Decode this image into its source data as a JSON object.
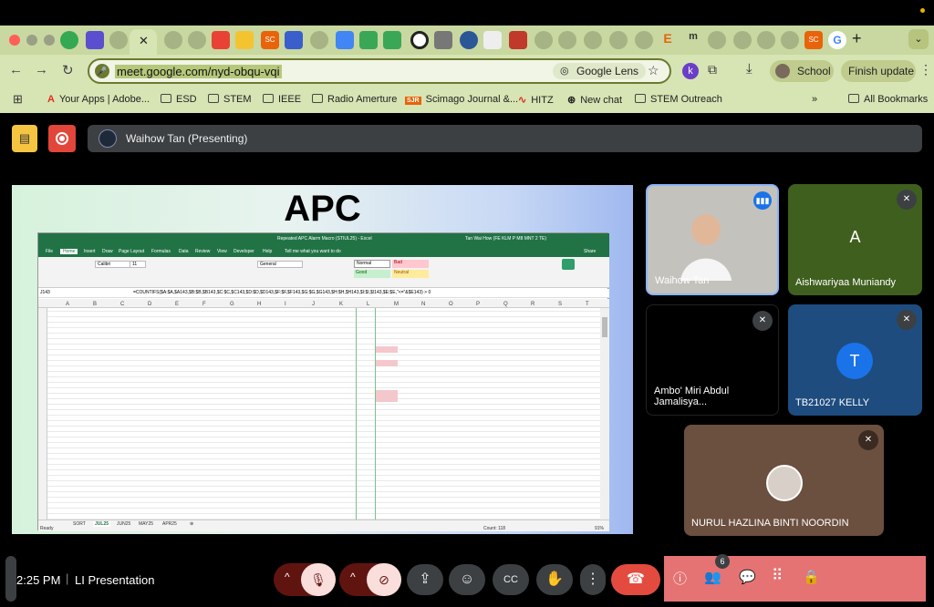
{
  "browser": {
    "url": "meet.google.com/nyd-obqu-vqi",
    "lens_label": "Google Lens",
    "profile_label": "School",
    "update_label": "Finish update",
    "extension_letter": "k"
  },
  "bookmarks": [
    {
      "label": "Your Apps | Adobe..."
    },
    {
      "label": "ESD"
    },
    {
      "label": "STEM"
    },
    {
      "label": "IEEE"
    },
    {
      "label": "Radio Amerture"
    },
    {
      "label": "Scimago Journal &..."
    },
    {
      "label": "HITZ"
    },
    {
      "label": "New chat"
    },
    {
      "label": "STEM Outreach"
    }
  ],
  "all_bookmarks": "All Bookmarks",
  "meet": {
    "presenter_label": "Waihow Tan (Presenting)",
    "time": "2:25 PM",
    "meeting_name": "LI Presentation",
    "participant_count": "6"
  },
  "slide": {
    "title": "APC",
    "excel": {
      "window_title": "Repeated APC Alarm Macro (STIUL25)  -  Excel",
      "user": "Tan Wai How (FE KLM P M8 MNT 2 TE)",
      "ribbon_tabs": [
        "File",
        "Home",
        "Insert",
        "Draw",
        "Page Layout",
        "Formulas",
        "Data",
        "Review",
        "View",
        "Developer",
        "Help"
      ],
      "tell_me": "Tell me what you want to do",
      "share": "Share",
      "font": "Calibri",
      "font_size": "11",
      "number_format": "General",
      "styles": {
        "normal": "Normal",
        "bad": "Bad",
        "good": "Good",
        "neutral": "Neutral"
      },
      "cell_ref": "J143",
      "formula": "=COUNTIFS($A:$A,$A143,$B:$B,$B143,$C:$C,$C143,$D:$D,$D143,$F:$F,$F143,$G:$G,$G143,$H:$H,$H143,$I:$I,$I143,$E:$E,\"<=\"&$E143) > 0",
      "columns": [
        "A",
        "B",
        "C",
        "D",
        "E",
        "F",
        "G",
        "H",
        "I",
        "J",
        "K",
        "L",
        "M",
        "N",
        "O",
        "P",
        "Q",
        "R",
        "S",
        "T"
      ],
      "sheets": [
        "SORT",
        "JUL25",
        "JUN25",
        "MAY25",
        "APR25"
      ],
      "active_sheet": "JUL25",
      "status_ready": "Ready",
      "status_count": "Count: 118",
      "zoom": "91%"
    }
  },
  "participants": [
    {
      "name": "Waihow Tan",
      "initial": "",
      "muted": false
    },
    {
      "name": "Aishwariyaa Muniandy",
      "initial": "A",
      "muted": true
    },
    {
      "name": "Ambo' Miri Abdul Jamalisya...",
      "initial": "",
      "muted": true
    },
    {
      "name": "TB21027 KELLY",
      "initial": "T",
      "muted": true
    },
    {
      "name": "NURUL HAZLINA BINTI NOORDIN",
      "initial": "",
      "muted": true
    }
  ]
}
